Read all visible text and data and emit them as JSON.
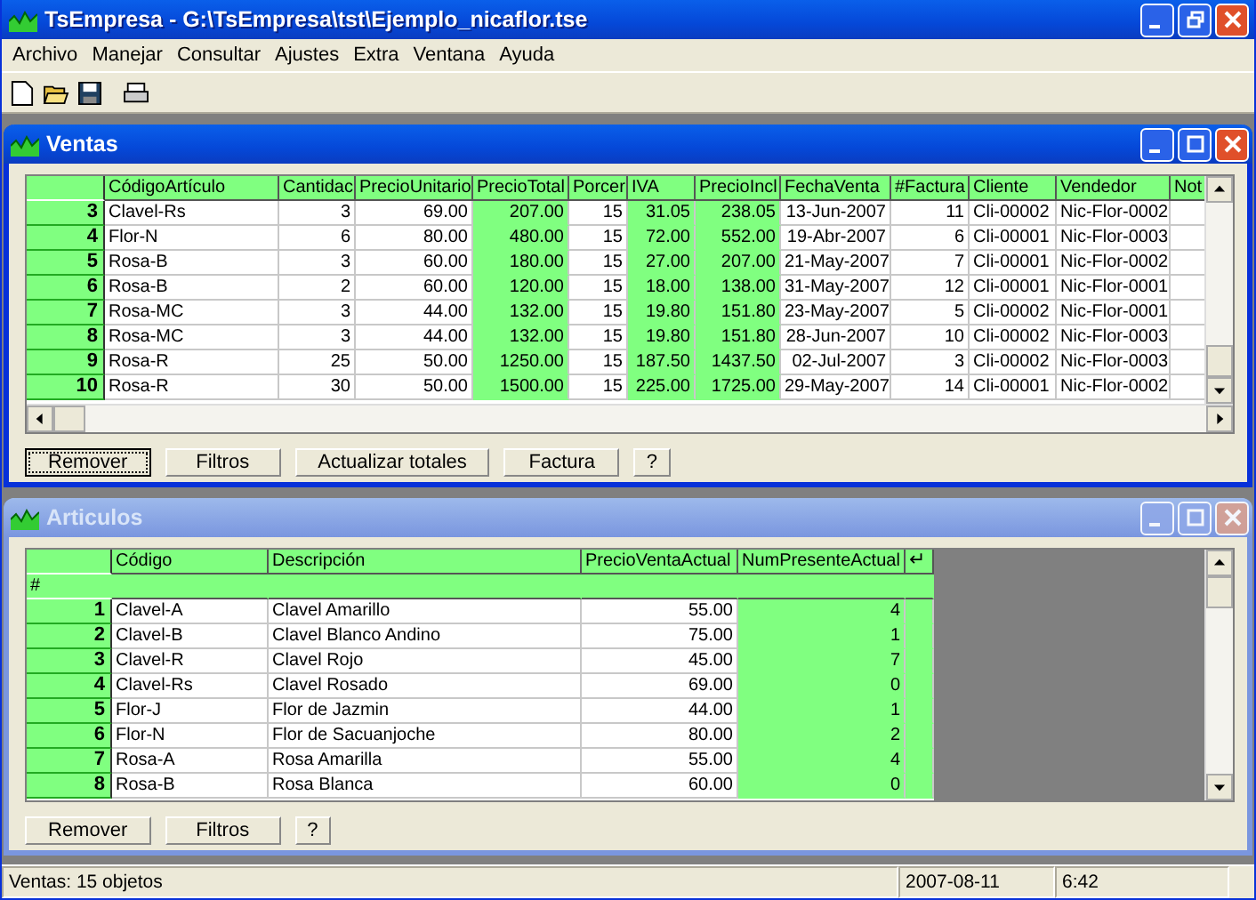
{
  "app": {
    "title": "TsEmpresa - G:\\TsEmpresa\\tst\\Ejemplo_nicaflor.tse"
  },
  "menu": [
    "Archivo",
    "Manejar",
    "Consultar",
    "Ajustes",
    "Extra",
    "Ventana",
    "Ayuda"
  ],
  "windows": [
    {
      "title": "Ventas",
      "active": true,
      "columns": [
        {
          "label": "CódigoArtículo",
          "numeric": false,
          "computed": false
        },
        {
          "label": "Cantidac",
          "numeric": true,
          "computed": false
        },
        {
          "label": "PrecioUnitario",
          "numeric": true,
          "computed": false
        },
        {
          "label": "PrecioTotal",
          "numeric": true,
          "computed": true
        },
        {
          "label": "Porcer",
          "numeric": true,
          "computed": false
        },
        {
          "label": "IVA",
          "numeric": true,
          "computed": true
        },
        {
          "label": "PrecioIncl",
          "numeric": true,
          "computed": true
        },
        {
          "label": "FechaVenta",
          "numeric": true,
          "computed": false
        },
        {
          "label": "#Factura",
          "numeric": true,
          "computed": false
        },
        {
          "label": "Cliente",
          "numeric": false,
          "computed": false
        },
        {
          "label": "Vendedor",
          "computed": false
        },
        {
          "label": "Not",
          "computed": false
        }
      ],
      "rows": [
        {
          "number": "3",
          "cells": [
            "Clavel-Rs",
            "3",
            "69.00",
            "207.00",
            "15",
            "31.05",
            "238.05",
            "13-Jun-2007",
            "11",
            "Cli-00002",
            "Nic-Flor-0002"
          ]
        },
        {
          "number": "4",
          "cells": [
            "Flor-N",
            "6",
            "80.00",
            "480.00",
            "15",
            "72.00",
            "552.00",
            "19-Abr-2007",
            "6",
            "Cli-00001",
            "Nic-Flor-0003"
          ]
        },
        {
          "number": "5",
          "cells": [
            "Rosa-B",
            "3",
            "60.00",
            "180.00",
            "15",
            "27.00",
            "207.00",
            "21-May-2007",
            "7",
            "Cli-00001",
            "Nic-Flor-0002"
          ]
        },
        {
          "number": "6",
          "cells": [
            "Rosa-B",
            "2",
            "60.00",
            "120.00",
            "15",
            "18.00",
            "138.00",
            "31-May-2007",
            "12",
            "Cli-00001",
            "Nic-Flor-0001"
          ]
        },
        {
          "number": "7",
          "cells": [
            "Rosa-MC",
            "3",
            "44.00",
            "132.00",
            "15",
            "19.80",
            "151.80",
            "23-May-2007",
            "5",
            "Cli-00002",
            "Nic-Flor-0001"
          ]
        },
        {
          "number": "8",
          "cells": [
            "Rosa-MC",
            "3",
            "44.00",
            "132.00",
            "15",
            "19.80",
            "151.80",
            "28-Jun-2007",
            "10",
            "Cli-00002",
            "Nic-Flor-0003"
          ]
        },
        {
          "number": "9",
          "cells": [
            "Rosa-R",
            "25",
            "50.00",
            "1250.00",
            "15",
            "187.50",
            "1437.50",
            "02-Jul-2007",
            "3",
            "Cli-00002",
            "Nic-Flor-0003"
          ]
        },
        {
          "number": "10",
          "cells": [
            "Rosa-R",
            "30",
            "50.00",
            "1500.00",
            "15",
            "225.00",
            "1725.00",
            "29-May-2007",
            "14",
            "Cli-00001",
            "Nic-Flor-0002"
          ]
        }
      ],
      "buttons": [
        {
          "label": "Remover",
          "focused": true
        },
        {
          "label": "Filtros",
          "focused": false
        },
        {
          "label": "Actualizar totales",
          "focused": false
        },
        {
          "label": "Factura",
          "focused": false
        },
        {
          "label": "?",
          "focused": false
        }
      ]
    },
    {
      "title": "Articulos",
      "active": false,
      "subheader": "#",
      "header_end": "↵",
      "columns": [
        {
          "label": "Código",
          "numeric": false,
          "computed": false
        },
        {
          "label": "Descripción",
          "numeric": false,
          "computed": false
        },
        {
          "label": "PrecioVentaActual",
          "numeric": true,
          "computed": false
        },
        {
          "label": "NumPresenteActual",
          "numeric": true,
          "computed": true
        }
      ],
      "rows": [
        {
          "number": "1",
          "cells": [
            "Clavel-A",
            "Clavel Amarillo",
            "55.00",
            "4"
          ]
        },
        {
          "number": "2",
          "cells": [
            "Clavel-B",
            "Clavel Blanco Andino",
            "75.00",
            "1"
          ]
        },
        {
          "number": "3",
          "cells": [
            "Clavel-R",
            "Clavel Rojo",
            "45.00",
            "7"
          ]
        },
        {
          "number": "4",
          "cells": [
            "Clavel-Rs",
            "Clavel Rosado",
            "69.00",
            "0"
          ]
        },
        {
          "number": "5",
          "cells": [
            "Flor-J",
            "Flor de Jazmin",
            "44.00",
            "1"
          ]
        },
        {
          "number": "6",
          "cells": [
            "Flor-N",
            "Flor de Sacuanjoche",
            "80.00",
            "2"
          ]
        },
        {
          "number": "7",
          "cells": [
            "Rosa-A",
            "Rosa Amarilla",
            "55.00",
            "4"
          ]
        },
        {
          "number": "8",
          "cells": [
            "Rosa-B",
            "Rosa Blanca",
            "60.00",
            "0"
          ]
        }
      ],
      "buttons": [
        {
          "label": "Remover",
          "focused": false
        },
        {
          "label": "Filtros",
          "focused": false
        },
        {
          "label": "?",
          "focused": false
        }
      ]
    }
  ],
  "status_bar": {
    "message": "Ventas: 15 objetos",
    "date": "2007-08-11",
    "time": "6:42"
  }
}
